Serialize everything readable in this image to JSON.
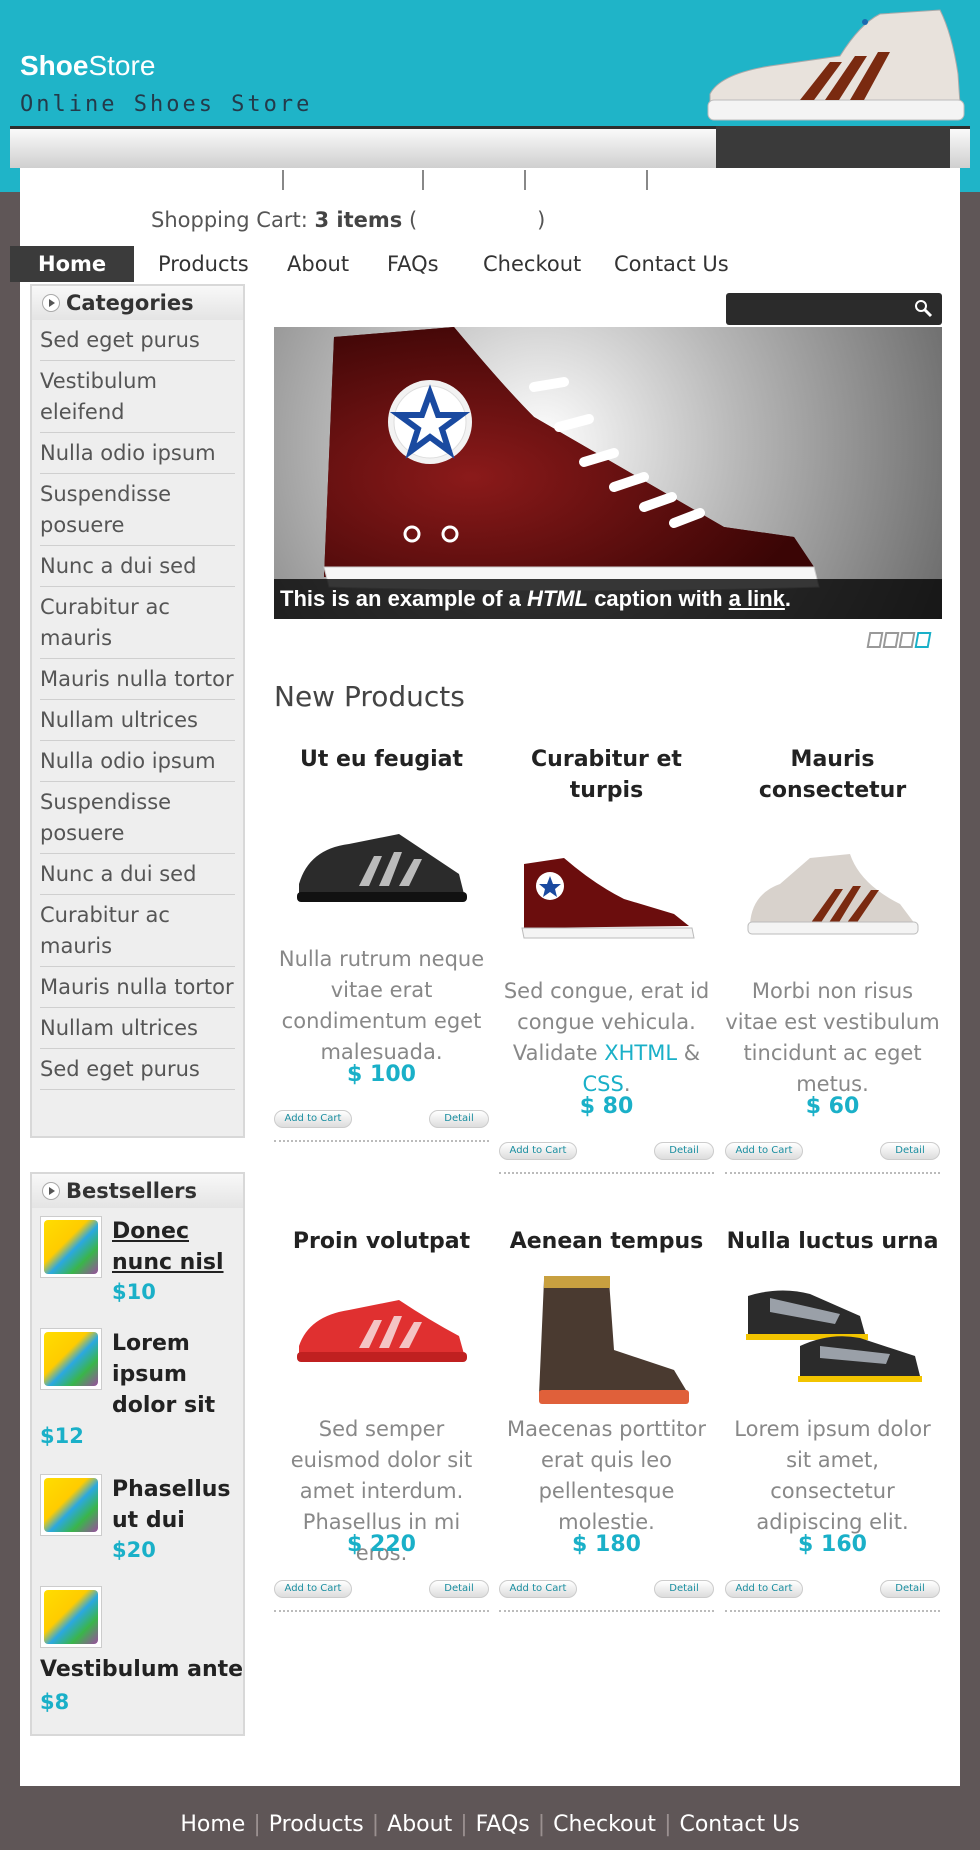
{
  "brand": {
    "name_bold": "Shoe",
    "name_rest": "Store",
    "tagline": "Online Shoes Store"
  },
  "cart": {
    "label": "Shopping Cart:",
    "count": "3 items",
    "open": "(",
    "close": ")"
  },
  "nav": [
    "Home",
    "Products",
    "About",
    "FAQs",
    "Checkout",
    "Contact Us"
  ],
  "categories": {
    "title": "Categories",
    "items": [
      "Sed eget purus",
      "Vestibulum eleifend",
      "Nulla odio ipsum",
      "Suspendisse posuere",
      "Nunc a dui sed",
      "Curabitur ac mauris",
      "Mauris nulla tortor",
      "Nullam ultrices",
      "Nulla odio ipsum",
      "Suspendisse posuere",
      "Nunc a dui sed",
      "Curabitur ac mauris",
      "Mauris nulla tortor",
      "Nullam ultrices",
      "Sed eget purus"
    ]
  },
  "bestsellers": {
    "title": "Bestsellers",
    "items": [
      {
        "name": "Donec nunc nisl",
        "price": "$10"
      },
      {
        "name": "Lorem ipsum dolor sit",
        "price": "$12"
      },
      {
        "name": "Phasellus ut dui",
        "price": "$20"
      },
      {
        "name": "Vestibulum ante",
        "price": "$8"
      }
    ]
  },
  "slider": {
    "caption_a": "This is an example of a ",
    "caption_em": "HTML",
    "caption_b": " caption with ",
    "caption_link": "a link",
    "caption_end": "."
  },
  "new_products": {
    "title": "New Products",
    "add_label": "Add to Cart",
    "detail_label": "Detail",
    "items": [
      {
        "title": "Ut eu feugiat",
        "desc": "Nulla rutrum neque vitae erat condimentum eget malesuada.",
        "price": "$ 100"
      },
      {
        "title": "Curabitur et turpis",
        "desc_a": "Sed congue, erat id congue vehicula. Validate ",
        "link1": "XHTML",
        "amp": " & ",
        "link2": "CSS",
        "desc_end": ".",
        "price": "$ 80"
      },
      {
        "title": "Mauris consectetur",
        "desc": "Morbi non risus vitae est vestibulum tincidunt ac eget metus.",
        "price": "$ 60"
      },
      {
        "title": "Proin volutpat",
        "desc": "Sed semper euismod dolor sit amet interdum. Phasellus in mi eros.",
        "price": "$ 220"
      },
      {
        "title": "Aenean tempus",
        "desc": "Maecenas porttitor erat quis leo pellentesque molestie.",
        "price": "$ 180"
      },
      {
        "title": "Nulla luctus urna",
        "desc": "Lorem ipsum dolor sit amet, consectetur adipiscing elit.",
        "price": "$ 160"
      }
    ]
  },
  "footer": [
    "Home",
    "Products",
    "About",
    "FAQs",
    "Checkout",
    "Contact Us"
  ],
  "colors": {
    "accent": "#1ab0c8",
    "header": "#1fb4c8",
    "background": "#5f5657"
  },
  "icons": {
    "search": "search-icon",
    "category_arrow": "arrow-right-icon"
  }
}
